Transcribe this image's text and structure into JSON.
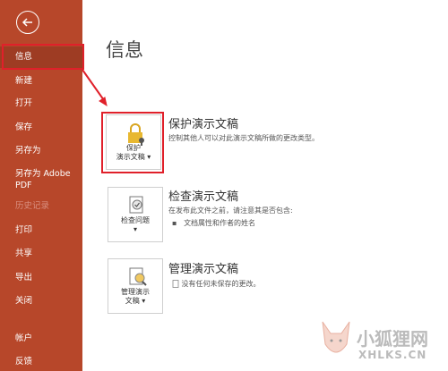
{
  "sidebar": {
    "items": [
      {
        "label": "信息"
      },
      {
        "label": "新建"
      },
      {
        "label": "打开"
      },
      {
        "label": "保存"
      },
      {
        "label": "另存为"
      },
      {
        "label": "另存为 Adobe PDF"
      },
      {
        "label": "历史记录"
      },
      {
        "label": "打印"
      },
      {
        "label": "共享"
      },
      {
        "label": "导出"
      },
      {
        "label": "关闭"
      },
      {
        "label": "帐户"
      },
      {
        "label": "反馈"
      }
    ]
  },
  "main": {
    "title": "信息",
    "protect": {
      "button_line1": "保护",
      "button_line2": "演示文稿",
      "title": "保护演示文稿",
      "desc": "控制其他人可以对此演示文稿所做的更改类型。"
    },
    "inspect": {
      "button_label": "检查问题",
      "title": "检查演示文稿",
      "desc": "在发布此文件之前，请注意其是否包含:",
      "bullet": "文档属性和作者的姓名"
    },
    "manage": {
      "button_line1": "管理演示",
      "button_line2": "文稿",
      "title": "管理演示文稿",
      "desc": "没有任何未保存的更改。"
    }
  },
  "watermark": {
    "text": "小狐狸网",
    "sub": "XHLKS.CN"
  },
  "colors": {
    "sidebar_bg": "#b7472a",
    "highlight": "#e0202a"
  }
}
